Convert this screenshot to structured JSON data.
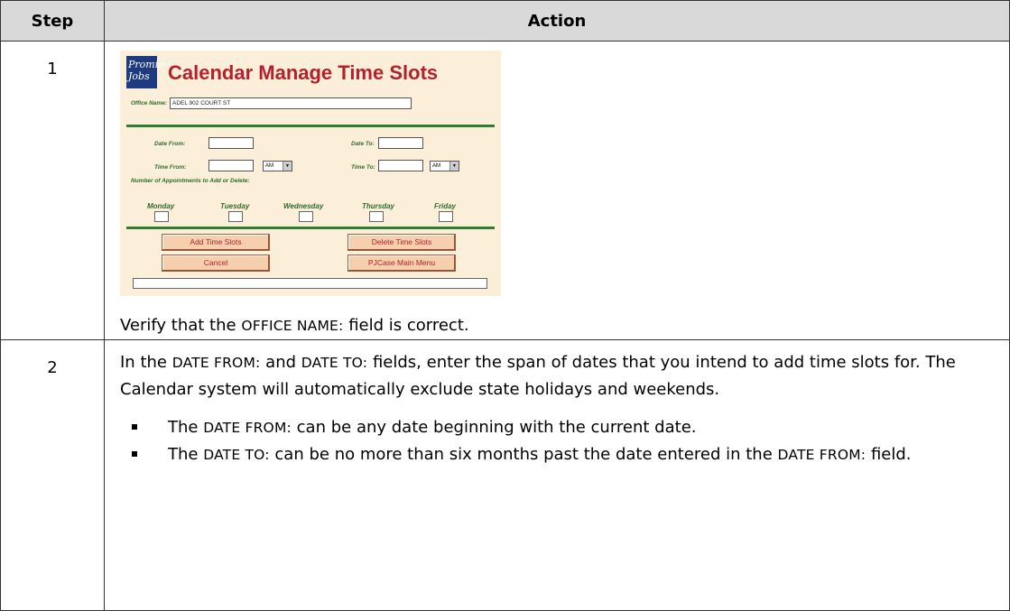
{
  "table": {
    "headers": {
      "step": "Step",
      "action": "Action"
    }
  },
  "screenshot": {
    "logo_text": "Promise Jobs",
    "title": "Calendar Manage Time Slots",
    "office_name_label": "Office Name:",
    "office_name_value": "ADEL 902 COURT ST",
    "date_from_label": "Date From:",
    "date_to_label": "Date To:",
    "time_from_label": "Time From:",
    "time_to_label": "Time To:",
    "ampm_from": "AM",
    "ampm_to": "AM",
    "appointments_label": "Number of Appointments to Add or Delete:",
    "days": [
      "Monday",
      "Tuesday",
      "Wednesday",
      "Thursday",
      "Friday"
    ],
    "buttons": {
      "add": "Add Time Slots",
      "delete": "Delete Time Slots",
      "cancel": "Cancel",
      "main_menu": "PJCase Main Menu"
    }
  },
  "row1": {
    "step": "1",
    "verify_pre": "Verify that the ",
    "verify_field": "OFFICE NAME:",
    "verify_post": " field is correct."
  },
  "row2": {
    "step": "2",
    "p_pre": "In the ",
    "p_field1": "DATE FROM:",
    "p_mid": " and ",
    "p_field2": "DATE TO:",
    "p_post": " fields, enter the span of dates that you intend to add time slots for. The Calendar system will automatically exclude state holidays and weekends.",
    "bullets": [
      {
        "pre": "The ",
        "field": "DATE FROM:",
        "post": " can be any date beginning with the current date."
      },
      {
        "pre": "The ",
        "field": "DATE TO:",
        "post": " can be no more than six months past the date entered in the ",
        "field2": "DATE FROM:",
        "post2": " field."
      }
    ]
  }
}
